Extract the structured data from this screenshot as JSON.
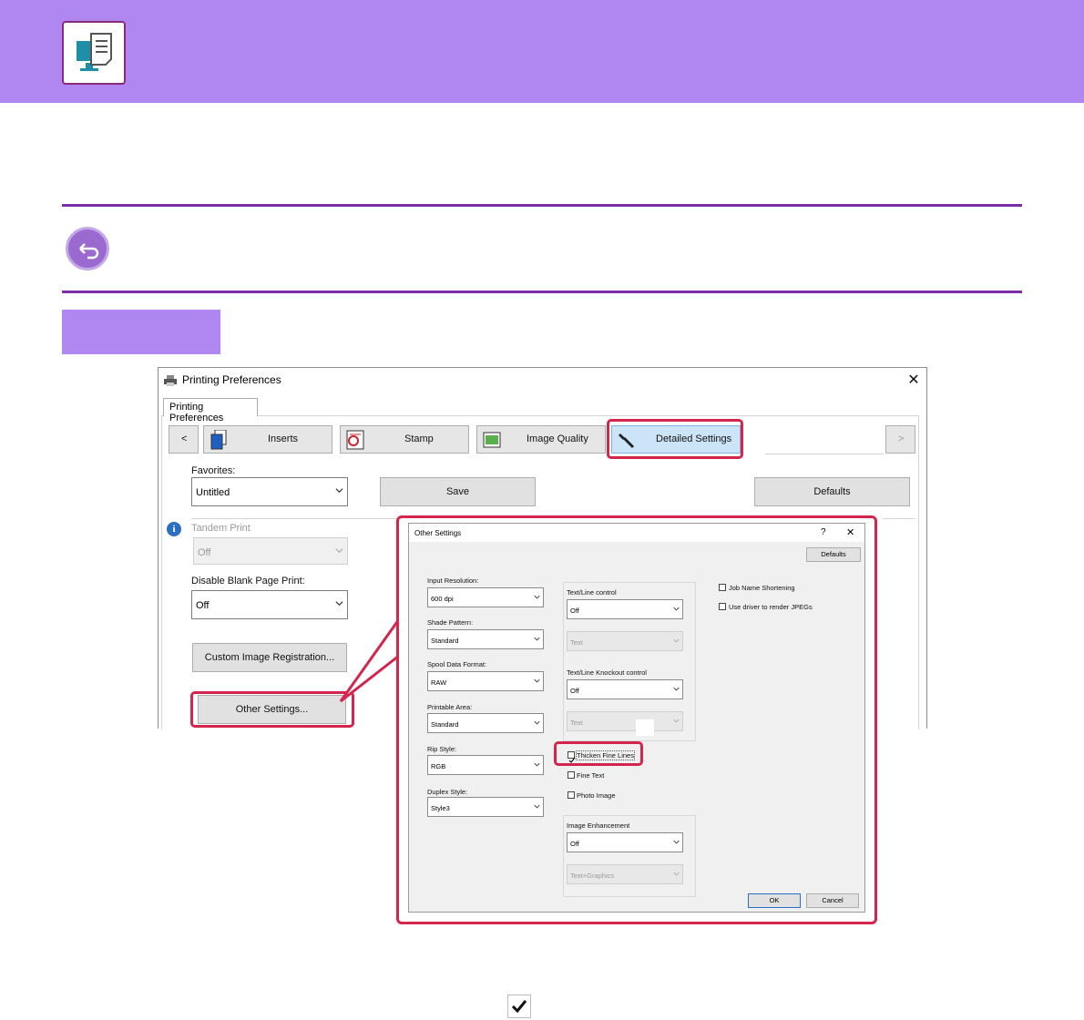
{
  "colors": {
    "banner": "#b086f0",
    "accent_line": "#7a2ea8",
    "highlight": "#d4254c"
  },
  "icons": [
    "computer-print-icon",
    "return-icon",
    "printer-icon",
    "inserts-icon",
    "stamp-icon",
    "image-quality-icon",
    "wrench-icon",
    "info-icon",
    "checkmark-icon"
  ],
  "dialog": {
    "title": "Printing Preferences",
    "close": "✕",
    "tab": "Printing Preferences",
    "nav_prev": "<",
    "nav_next": ">",
    "nav_tabs": [
      "Inserts",
      "Stamp",
      "Image Quality",
      "Detailed Settings"
    ],
    "favorites_label": "Favorites:",
    "favorites_value": "Untitled",
    "save": "Save",
    "defaults": "Defaults",
    "tandem_label": "Tandem Print",
    "tandem_value": "Off",
    "blank_label": "Disable Blank Page Print:",
    "blank_value": "Off",
    "custom_image": "Custom Image Registration...",
    "other_settings": "Other Settings..."
  },
  "other": {
    "title": "Other Settings",
    "help": "?",
    "close": "✕",
    "defaults": "Defaults",
    "input_resolution_label": "Input Resolution:",
    "input_resolution_value": "600 dpi",
    "shade_label": "Shade Pattern:",
    "shade_value": "Standard",
    "spool_label": "Spool Data Format:",
    "spool_value": "RAW",
    "printable_label": "Printable Area:",
    "printable_value": "Standard",
    "rip_label": "Rip Style:",
    "rip_value": "RGB",
    "duplex_label": "Duplex Style:",
    "duplex_value": "Style3",
    "textline_label": "Text/Line control",
    "textline_value": "Off",
    "textline_sub": "Text",
    "knockout_label": "Text/Line Knockout control",
    "knockout_value": "Off",
    "knockout_sub": "Text",
    "thicken": "Thicken Fine Lines",
    "thicken_checked": true,
    "fine_text": "Fine Text",
    "photo_image": "Photo Image",
    "enhancement_label": "Image Enhancement",
    "enhancement_value": "Off",
    "enhancement_sub": "Text+Graphics",
    "job_name": "Job Name Shortening",
    "use_driver": "Use driver to render JPEGs",
    "ok": "OK",
    "cancel": "Cancel"
  }
}
